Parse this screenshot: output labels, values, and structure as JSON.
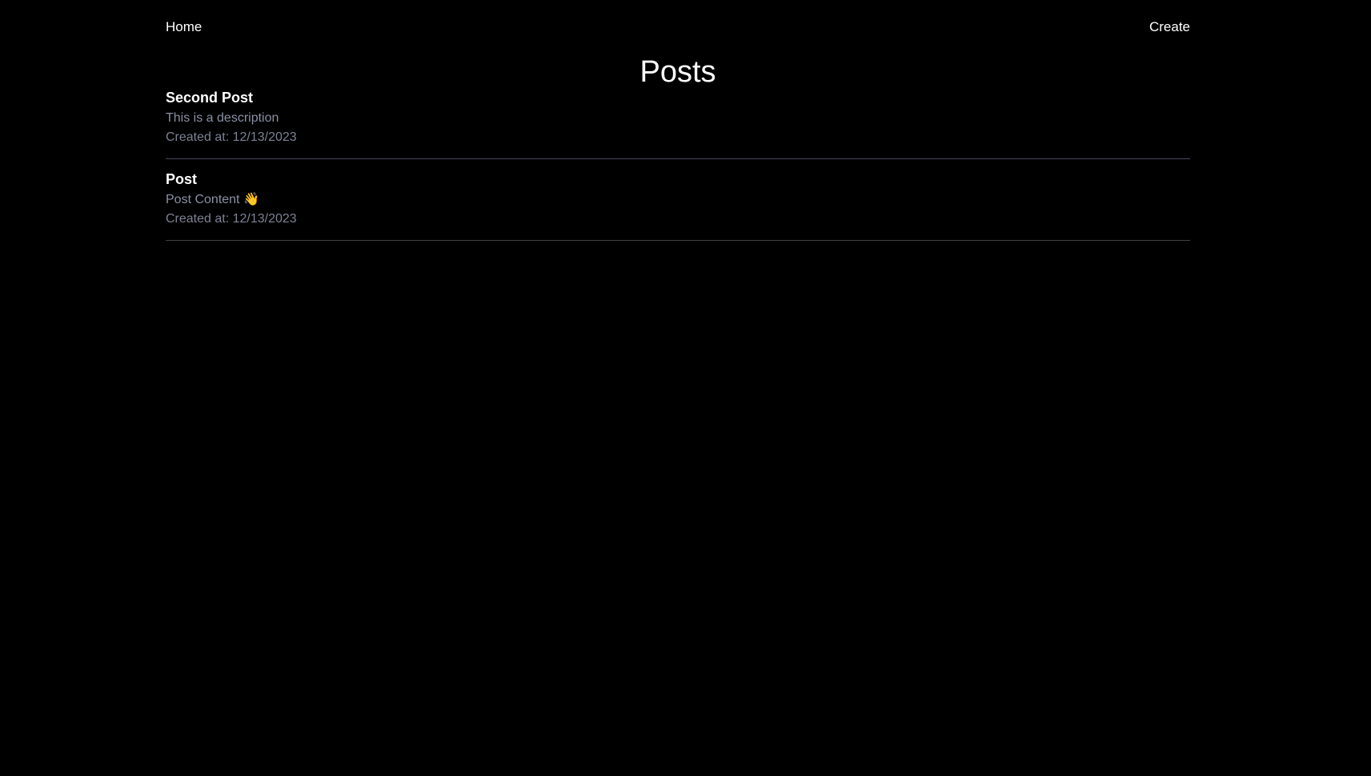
{
  "nav": {
    "home_label": "Home",
    "create_label": "Create"
  },
  "page": {
    "title": "Posts"
  },
  "posts": [
    {
      "title": "Second Post",
      "description": "This is a description",
      "created": "Created at: 12/13/2023"
    },
    {
      "title": "Post",
      "description": "Post Content 👋",
      "created": "Created at: 12/13/2023"
    }
  ],
  "colors": {
    "background": "#000000",
    "text": "#ffffff",
    "muted": "#8b8fa3",
    "divider": "#3f3f46"
  }
}
